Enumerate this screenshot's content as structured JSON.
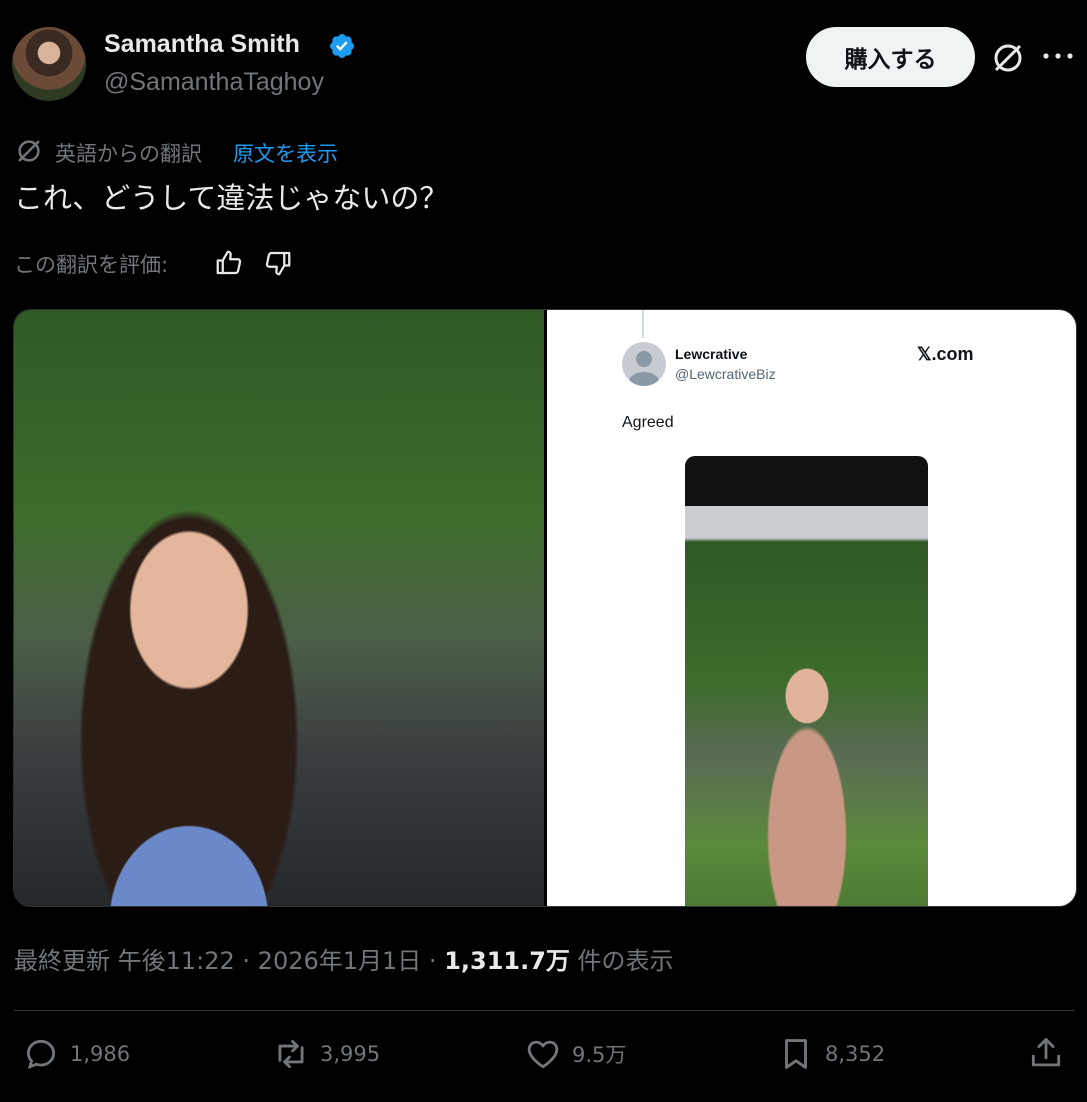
{
  "author": {
    "display_name": "Samantha Smith",
    "handle": "@SamanthaTaghoy",
    "verified": true,
    "verified_color": "#1d9bf0"
  },
  "header": {
    "buy_button_label": "購入する"
  },
  "translation": {
    "label": "英語からの翻訳",
    "show_original_label": "原文を表示",
    "rate_label": "この翻訳を評価:"
  },
  "tweet": {
    "text": "これ、どうして違法じゃないの？"
  },
  "embedded_post": {
    "name": "Lewcrative",
    "handle": "@LewcrativeBiz",
    "site": "𝕏.com",
    "text": "Agreed"
  },
  "meta": {
    "prefix": "最終更新 午後11:22 · 2026年1月1日 · ",
    "views_count": "1,311.7万",
    "views_suffix": " 件の表示"
  },
  "actions": {
    "replies": "1,986",
    "reposts": "3,995",
    "likes": "9.5万",
    "bookmarks": "8,352"
  },
  "icons": [
    "verified-badge-icon",
    "grok-icon",
    "more-icon",
    "translate-icon",
    "thumbs-up-icon",
    "thumbs-down-icon",
    "reply-icon",
    "repost-icon",
    "like-icon",
    "bookmark-icon",
    "share-icon"
  ],
  "colors": {
    "background": "#000000",
    "text": "#e7e9ea",
    "muted": "#71767b",
    "link": "#1d9bf0"
  }
}
